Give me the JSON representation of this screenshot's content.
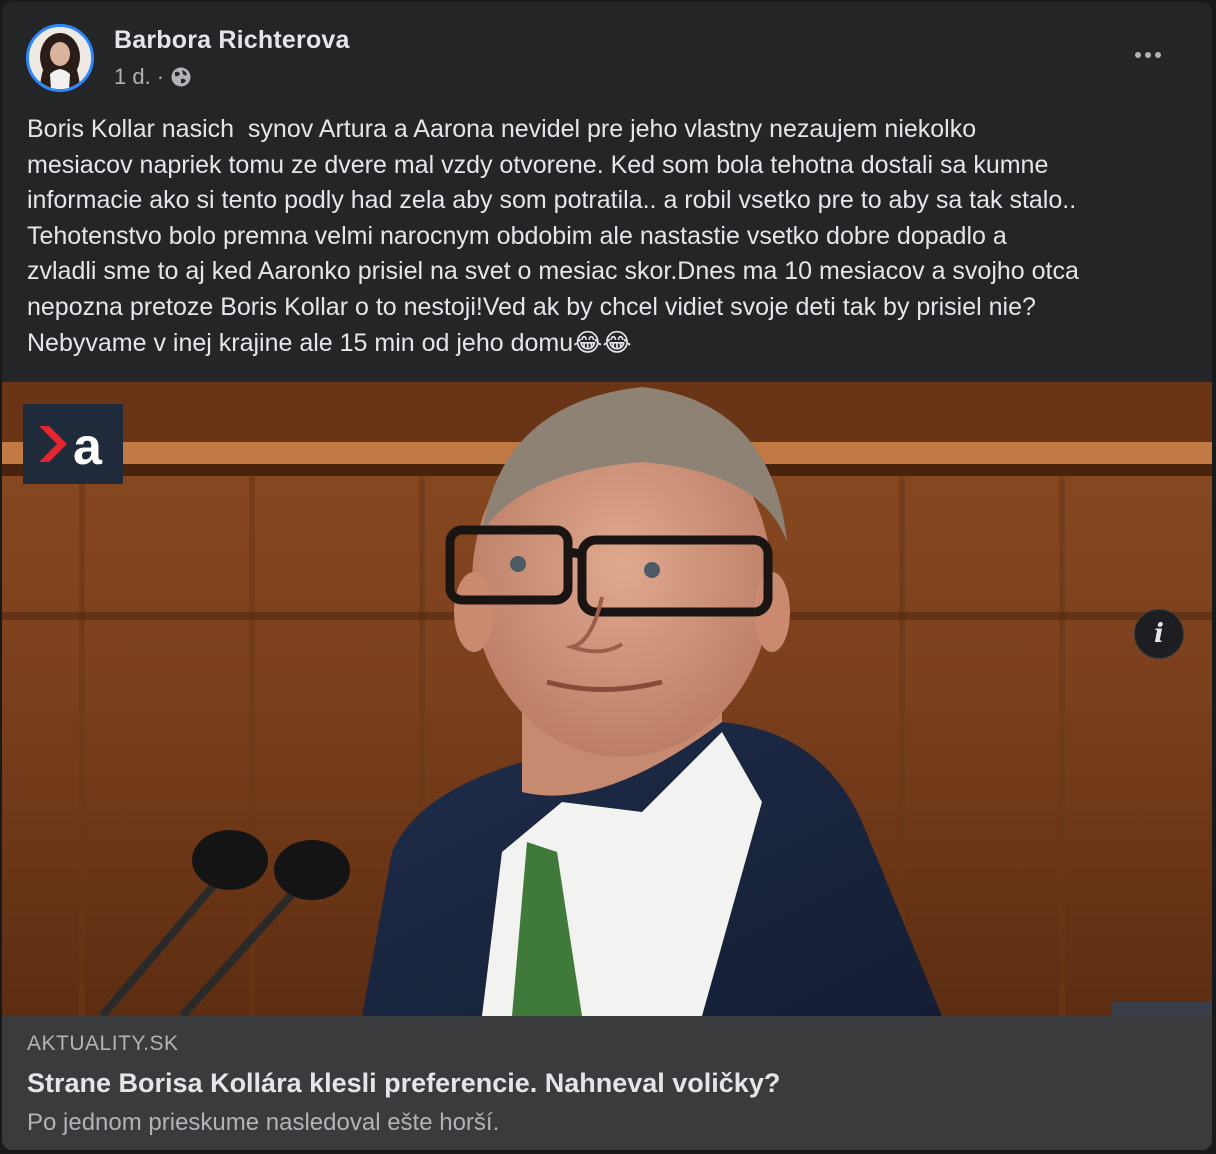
{
  "post": {
    "author": "Barbora Richterova",
    "time": "1 d.",
    "separator": "·",
    "audience_icon": "globe-icon",
    "more_icon": "more-options-icon",
    "text": "Boris Kollar nasich  synov Artura a Aarona nevidel pre jeho vlastny nezaujem niekolko\nmesiacov napriek tomu ze dvere mal vzdy otvorene. Ked som bola tehotna dostali sa kumne\ninformacie ako si tento podly had zela aby som potratila.. a robil vsetko pre to aby sa tak stalo..\nTehotenstvo bolo premna velmi narocnym obdobim ale nastastie vsetko dobre dopadlo a\nzvladli sme to aj ked Aaronko prisiel na svet o mesiac skor.Dnes ma 10 mesiacov a svojho otca\nnepozna pretoze Boris Kollar o to nestoji!Ved ak by chcel vidiet svoje deti tak by prisiel nie?\nNebyvame v inej krajine ale 15 min od jeho domu😂😂"
  },
  "link_preview": {
    "logo_text": "a",
    "info_label": "i",
    "domain": "AKTUALITY.SK",
    "title": "Strane Borisa Kollára klesli preferencie. Nahneval voličky?",
    "description": "Po jednom prieskume nasledoval ešte horší."
  },
  "colors": {
    "card_bg": "#242526",
    "text_primary": "#e4e6eb",
    "text_secondary": "#b0b3b8",
    "avatar_ring": "#2d88ff",
    "link_box_bg": "#3a3b3c",
    "logo_accent": "#e3262f"
  }
}
